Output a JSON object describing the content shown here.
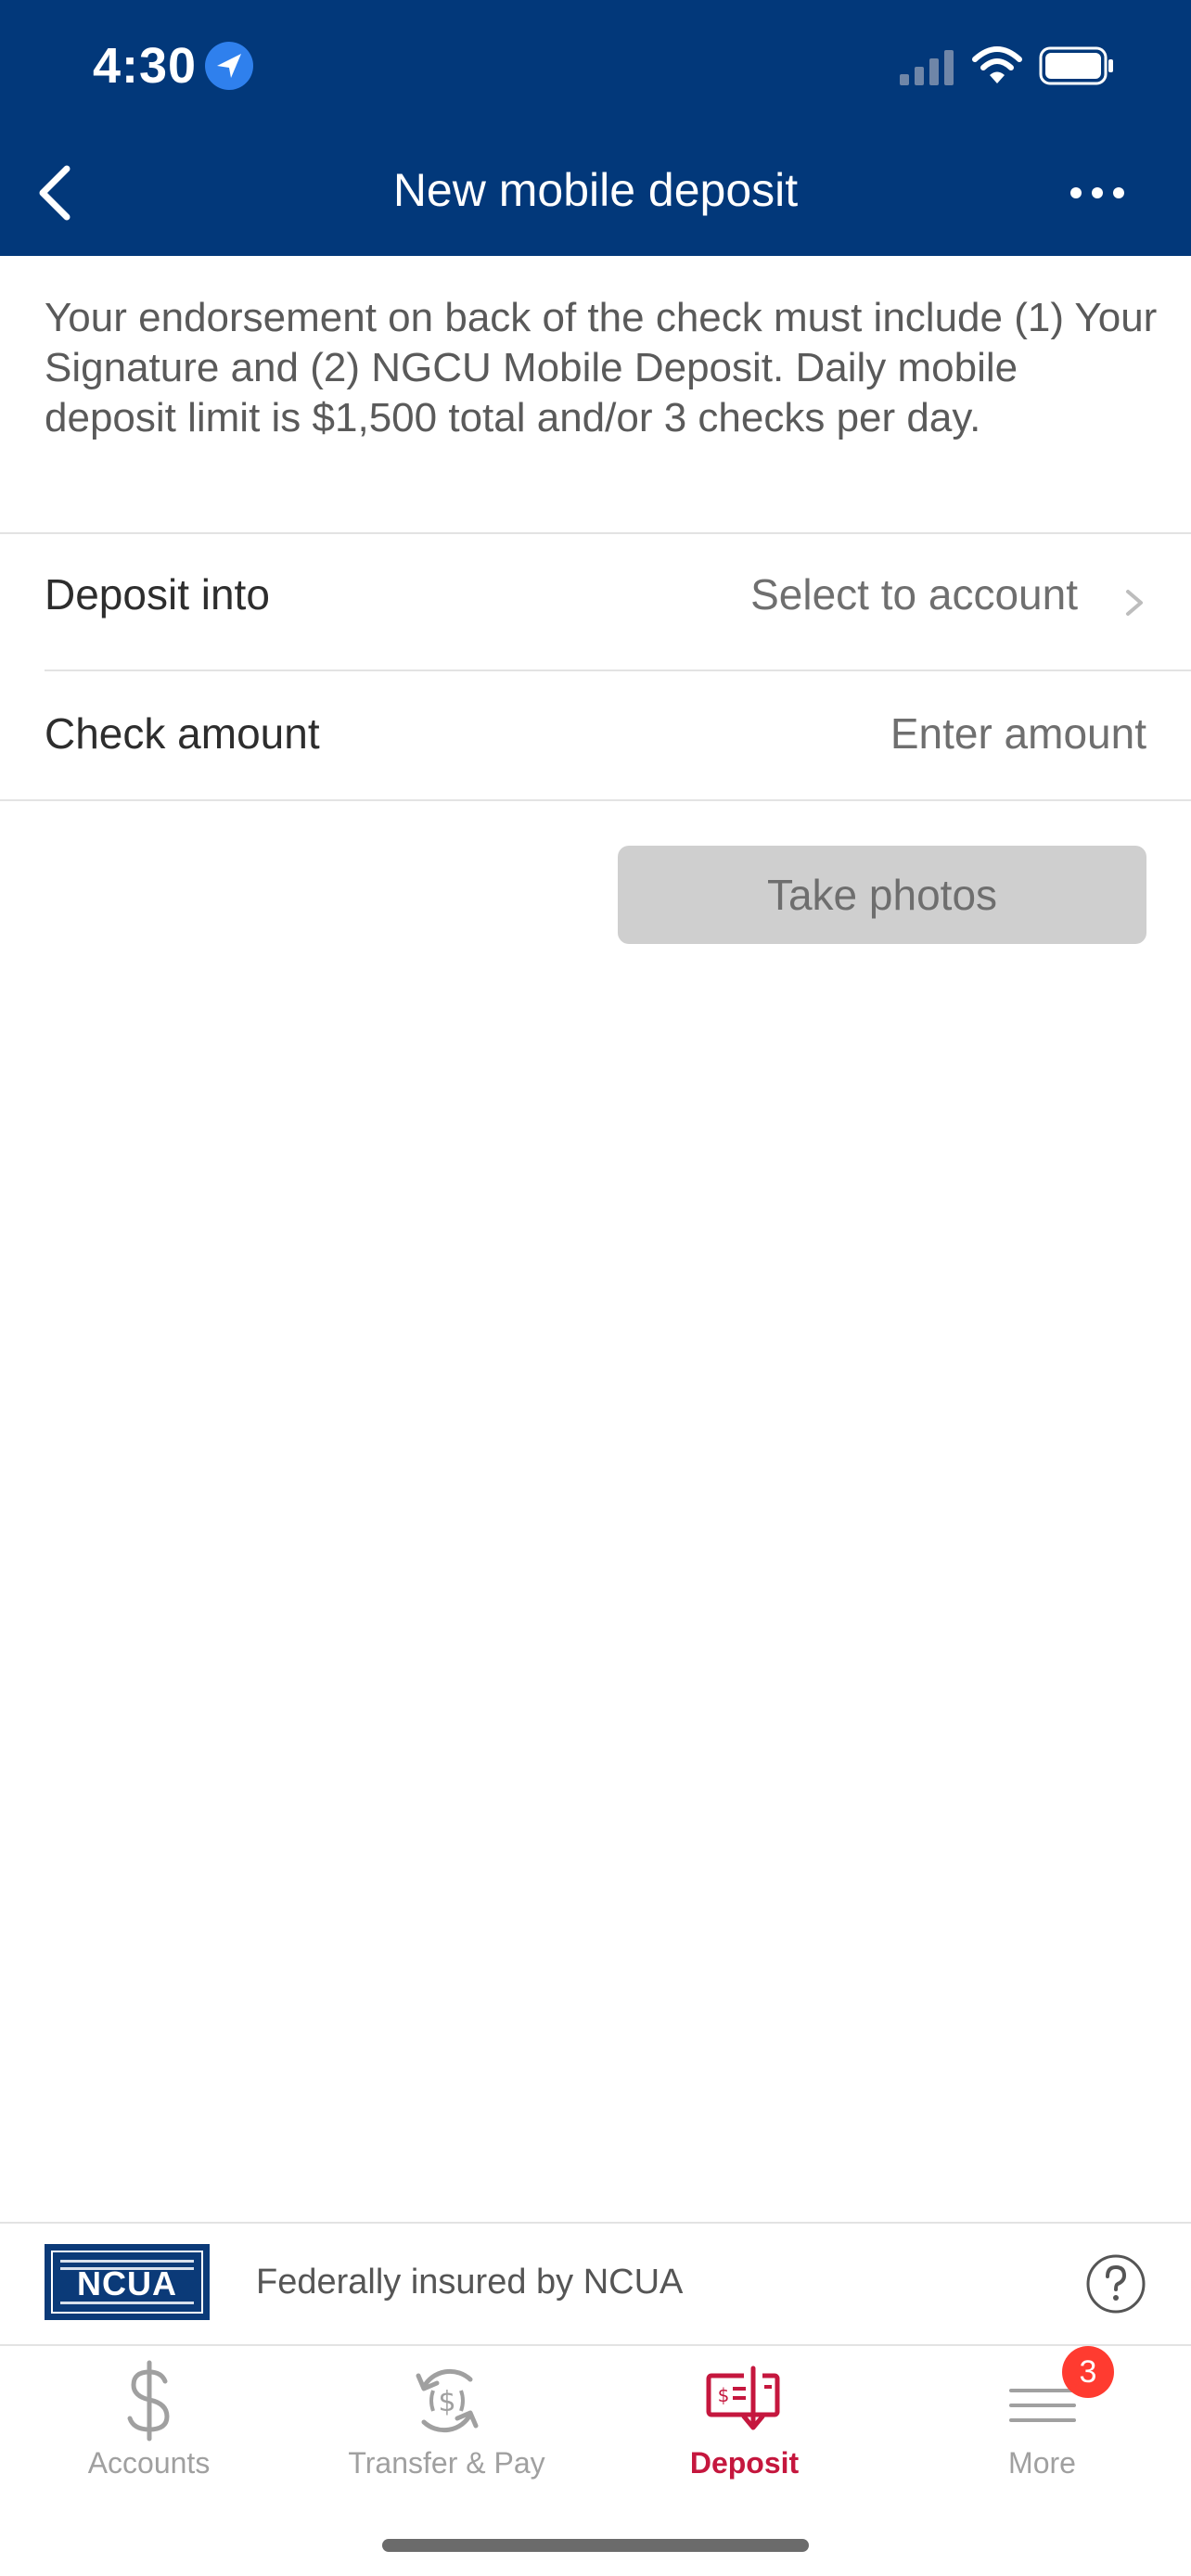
{
  "status_bar": {
    "time": "4:30"
  },
  "nav": {
    "title": "New mobile deposit"
  },
  "notice": "Your endorsement on back of the check must include (1) Your Signature and (2) NGCU Mobile Deposit. Daily mobile deposit limit is $1,500 total and/or 3 checks per day.",
  "form": {
    "deposit_into": {
      "label": "Deposit into",
      "value": "Select to account"
    },
    "check_amount": {
      "label": "Check amount",
      "placeholder": "Enter amount"
    }
  },
  "take_photos_label": "Take photos",
  "footer": {
    "logo_text": "NCUA",
    "insured_text": "Federally insured by NCUA"
  },
  "tabs": [
    {
      "label": "Accounts",
      "icon": "dollar-icon"
    },
    {
      "label": "Transfer & Pay",
      "icon": "transfer-pay-icon"
    },
    {
      "label": "Deposit",
      "icon": "check-deposit-icon",
      "active": true
    },
    {
      "label": "More",
      "icon": "menu-icon",
      "badge": "3"
    }
  ],
  "colors": {
    "header": "#02387a",
    "active_tab": "#c5173e",
    "badge": "#ff3b30",
    "button_disabled": "#cfcfcf"
  }
}
